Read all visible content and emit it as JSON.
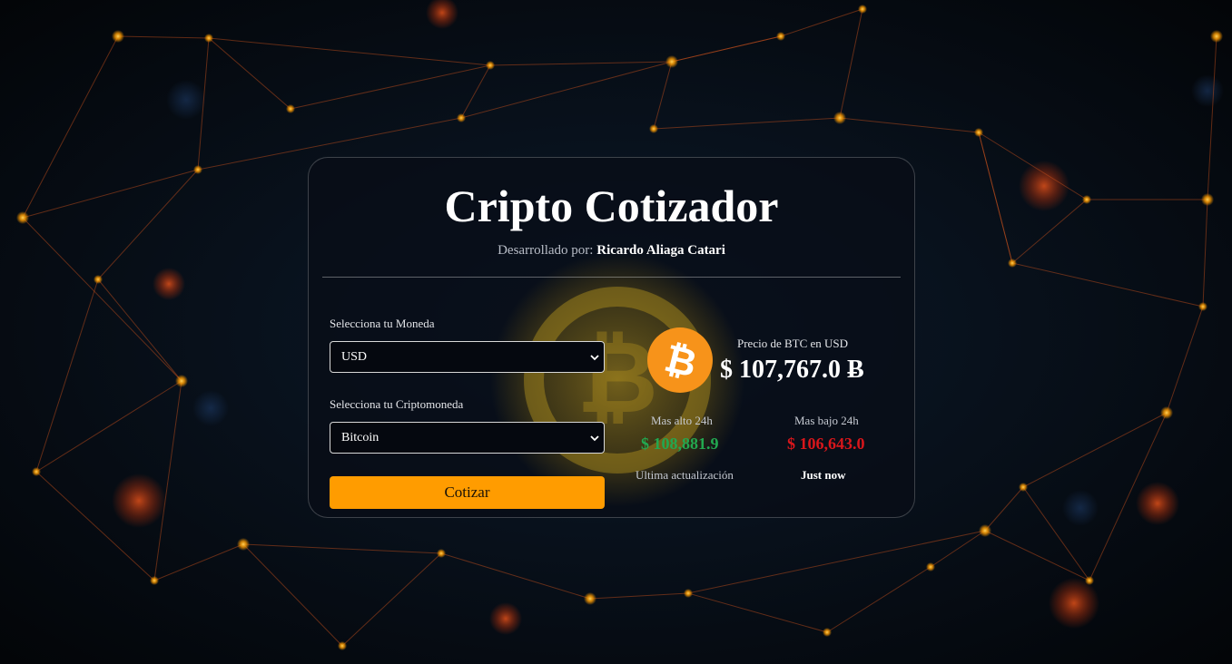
{
  "header": {
    "title": "Cripto Cotizador",
    "developed_by_label": "Desarrollado por:",
    "author": "Ricardo Aliaga Catari"
  },
  "form": {
    "currency_label": "Selecciona tu Moneda",
    "currency_value": "USD",
    "crypto_label": "Selecciona tu Criptomoneda",
    "crypto_value": "Bitcoin",
    "submit_label": "Cotizar"
  },
  "result": {
    "price_label": "Precio de BTC en USD",
    "price": "$ 107,767.0 Ƀ",
    "high_label": "Mas alto 24h",
    "high_value": "$ 108,881.9",
    "low_label": "Mas bajo 24h",
    "low_value": "$ 106,643.0",
    "updated_label": "Ultima actualización",
    "updated_value": "Just now"
  },
  "icons": {
    "coin": "bitcoin-icon",
    "select_arrow": "chevron-down-icon"
  },
  "colors": {
    "accent": "#ff9c00",
    "bitcoin": "#f7931a",
    "high": "#22a850",
    "low": "#d8161b",
    "background": "#05080f"
  }
}
